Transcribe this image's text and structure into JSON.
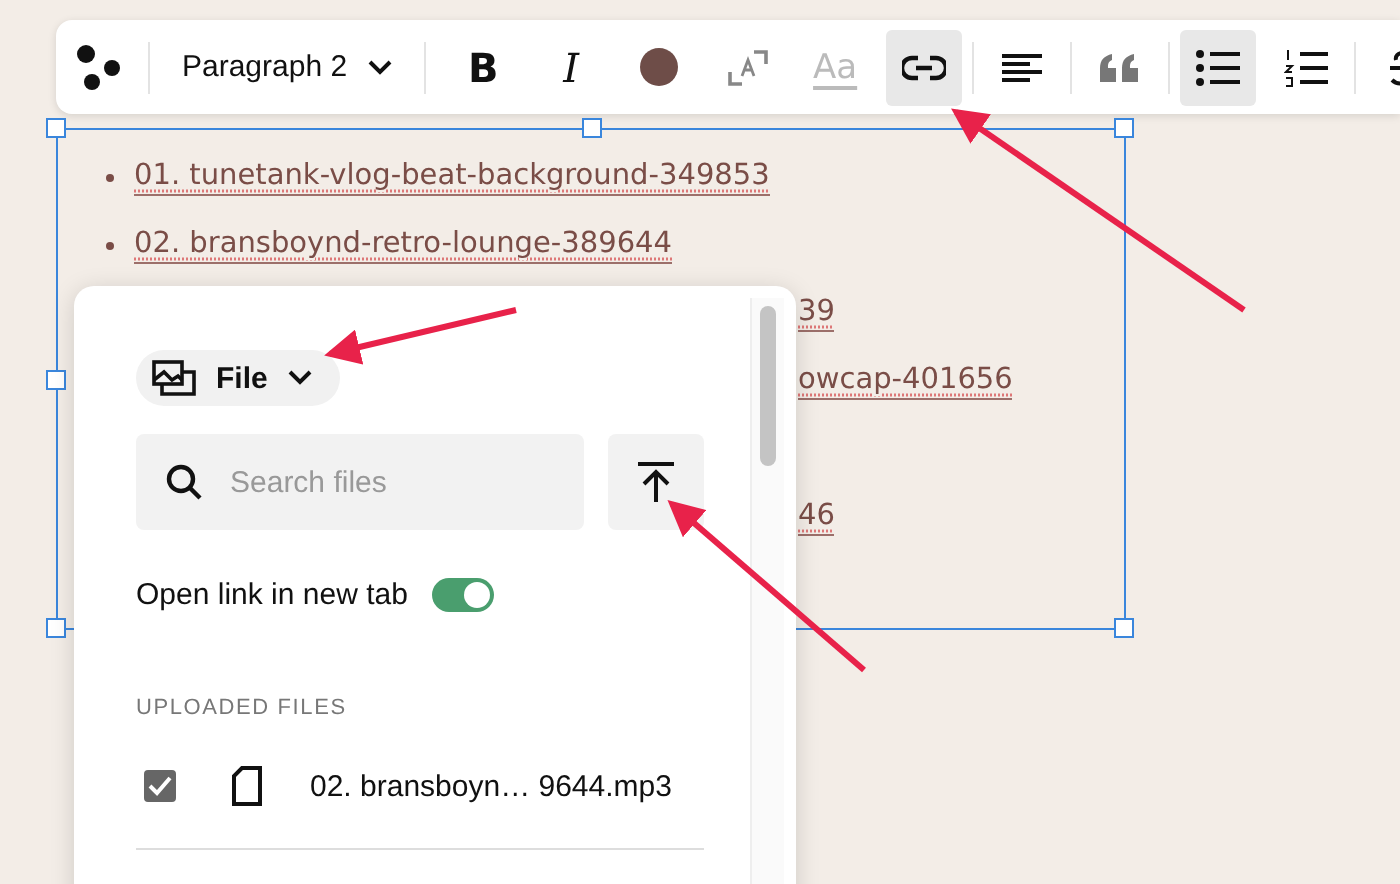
{
  "toolbar": {
    "style_dropdown": "Paragraph 2",
    "buttons": [
      {
        "kind": "bold",
        "label": "B",
        "selected": false
      },
      {
        "kind": "italic",
        "label": "I",
        "selected": false
      },
      {
        "kind": "color",
        "color": "#6e4d48",
        "selected": false
      },
      {
        "kind": "resize",
        "selected": false
      },
      {
        "kind": "style",
        "label": "Aa",
        "selected": false,
        "disabled": true
      },
      {
        "kind": "link",
        "selected": true
      },
      {
        "kind": "align",
        "selected": false
      },
      {
        "kind": "quote",
        "selected": false
      },
      {
        "kind": "bullets",
        "selected": true
      },
      {
        "kind": "numbers",
        "selected": false
      },
      {
        "kind": "strike",
        "selected": false
      }
    ]
  },
  "editor": {
    "items": [
      {
        "text": "01. tunetank-vlog-beat-background-349853",
        "partial": false
      },
      {
        "text": "02. bransboynd-retro-lounge-389644",
        "partial": false
      },
      {
        "text": "39",
        "partial": true
      },
      {
        "text": "owcap-401656",
        "partial": true
      },
      {
        "text": "46",
        "partial": true
      }
    ]
  },
  "popup": {
    "type_dropdown": "File",
    "search": {
      "placeholder": "Search files"
    },
    "open_in_new_tab": {
      "label": "Open link in new tab",
      "on": true
    },
    "section_title": "UPLOADED FILES",
    "files": [
      {
        "name": "02. bransboyn… 9644.mp3",
        "checked": true
      }
    ]
  }
}
